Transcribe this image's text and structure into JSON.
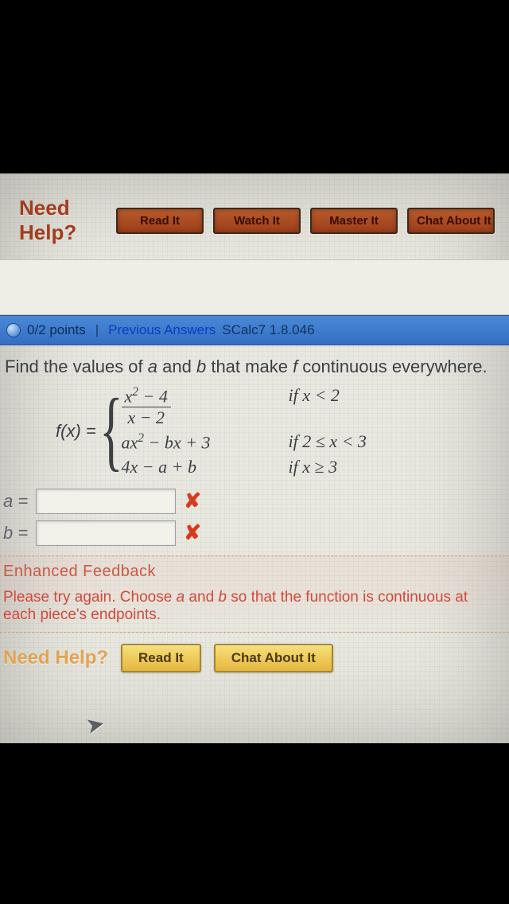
{
  "help_top": {
    "label": "Need Help?",
    "buttons": [
      "Read It",
      "Watch It",
      "Master It",
      "Chat About It"
    ]
  },
  "header": {
    "points": "0/2 points",
    "previous": "Previous Answers",
    "reference": "SCalc7 1.8.046"
  },
  "question": {
    "prompt_prefix": "Find the values of ",
    "var_a": "a",
    "mid": " and ",
    "var_b": "b",
    "prompt_suffix": " that make ",
    "var_f": "f",
    "prompt_tail": " continuous everywhere.",
    "lhs": "f(x) =",
    "cases": [
      {
        "expr_num": "x² − 4",
        "expr_den": "x − 2",
        "cond": "if x < 2"
      },
      {
        "expr": "ax² − bx + 3",
        "cond": "if 2 ≤ x < 3"
      },
      {
        "expr": "4x − a + b",
        "cond": "if x ≥ 3"
      }
    ]
  },
  "answers": {
    "a_label": "a =",
    "a_value": "",
    "a_correct": false,
    "b_label": "b =",
    "b_value": "",
    "b_correct": false
  },
  "feedback": {
    "title": "Enhanced Feedback",
    "line1_prefix": "Please try again. Choose ",
    "a": "a",
    "and": " and ",
    "b": "b",
    "line1_suffix": " so that the function is continuous at",
    "line2": "each piece's endpoints."
  },
  "help_bottom": {
    "label": "Need Help?",
    "buttons": [
      "Read It",
      "Chat About It"
    ]
  }
}
